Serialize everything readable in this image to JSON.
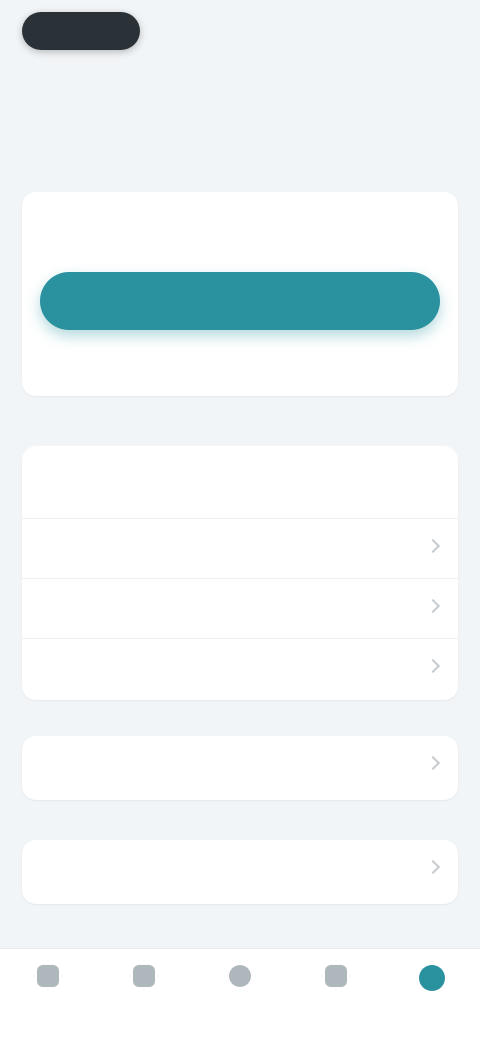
{
  "status_bar": {
    "time": ""
  },
  "page": {
    "title": ""
  },
  "account": {
    "heading": "",
    "subtitle": "",
    "primary_button": "",
    "secondary_link": ""
  },
  "preferences": {
    "section_label": "",
    "rows": [
      {
        "label": ""
      },
      {
        "label": ""
      },
      {
        "label": ""
      }
    ]
  },
  "support": {
    "label": ""
  },
  "about": {
    "label": ""
  },
  "footer": {
    "label": ""
  },
  "colors": {
    "accent": "#2a929e",
    "background": "#f2f5f7",
    "card": "#ffffff"
  },
  "bottom_nav": {
    "items": [
      {
        "icon": "home-icon",
        "label": ""
      },
      {
        "icon": "list-icon",
        "label": ""
      },
      {
        "icon": "add-icon",
        "label": ""
      },
      {
        "icon": "chart-icon",
        "label": ""
      },
      {
        "icon": "settings-icon",
        "label": "",
        "active": true
      }
    ]
  }
}
